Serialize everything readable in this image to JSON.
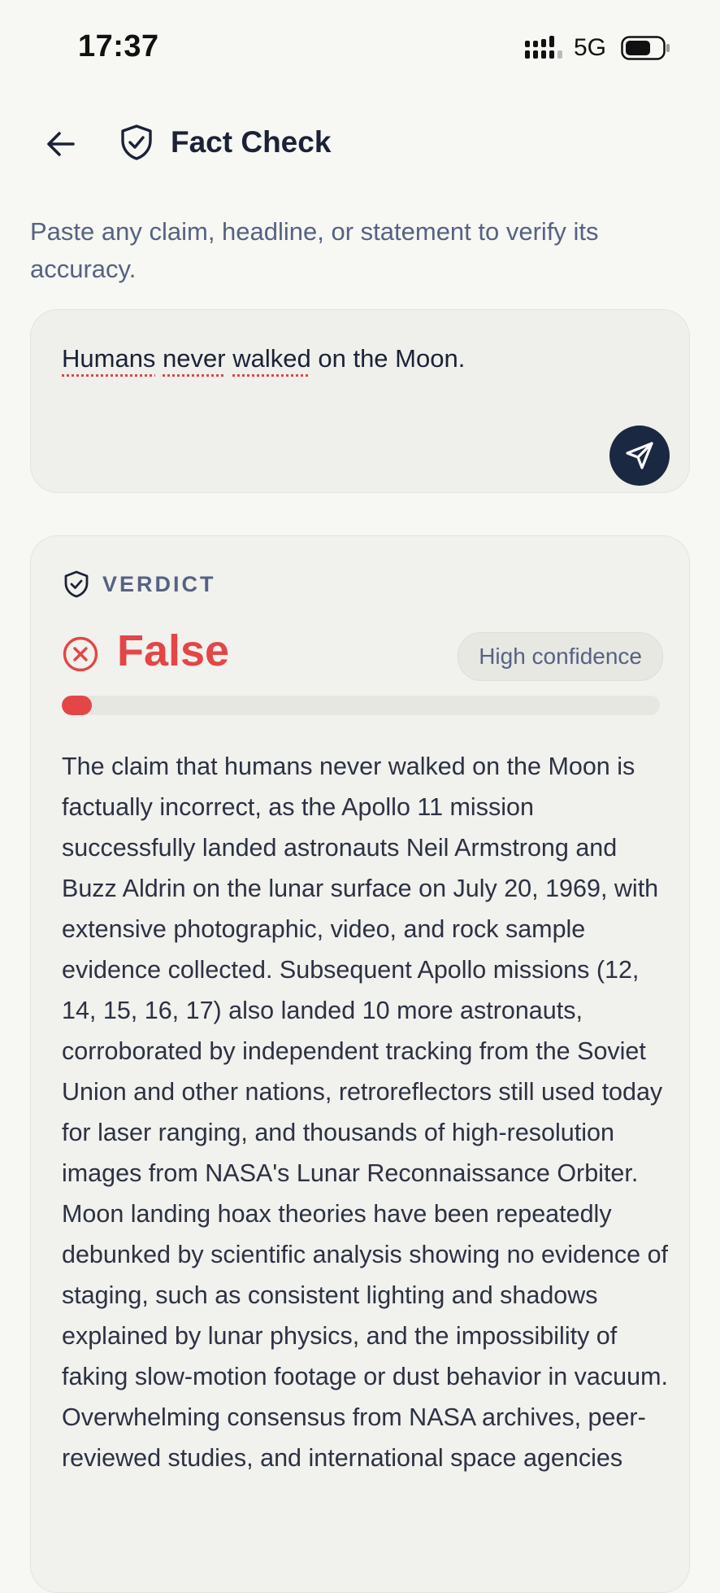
{
  "status_bar": {
    "time": "17:37",
    "network": "5G"
  },
  "header": {
    "title": "Fact Check"
  },
  "intro": {
    "text": "Paste any claim, headline, or statement to verify its accuracy."
  },
  "claim": {
    "words": [
      "Humans",
      "never",
      "walked",
      "on the Moon."
    ]
  },
  "verdict": {
    "label": "VERDICT",
    "result": "False",
    "confidence": "High confidence",
    "progress_fraction": 0.05,
    "color": "#e34646",
    "explanation": "The claim that humans never walked on the Moon is factually incorrect, as the Apollo 11 mission successfully landed astronauts Neil Armstrong and Buzz Aldrin on the lunar surface on July 20, 1969, with extensive photographic, video, and rock sample evidence collected. Subsequent Apollo missions (12, 14, 15, 16, 17) also landed 10 more astronauts, corroborated by independent tracking from the Soviet Union and other nations, retroreflectors still used today for laser ranging, and thousands of high-resolution images from NASA's Lunar Reconnaissance Orbiter. Moon landing hoax theories have been repeatedly debunked by scientific analysis showing no evidence of staging, such as consistent lighting and shadows explained by lunar physics, and the impossibility of faking slow-motion footage or dust behavior in vacuum. Overwhelming consensus from NASA archives, peer-reviewed studies, and international space agencies"
  },
  "icons": {
    "back": "arrow-left-icon",
    "title": "shield-check-icon",
    "send": "send-icon",
    "verdict": "shield-check-icon",
    "result": "x-circle-icon"
  }
}
